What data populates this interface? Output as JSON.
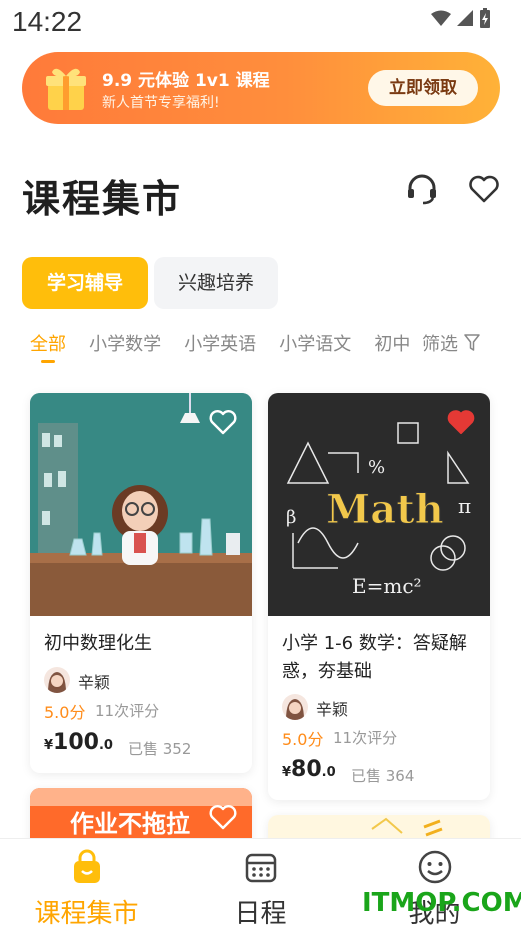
{
  "status": {
    "time": "14:22"
  },
  "promo": {
    "title": "9.9 元体验 1v1 课程",
    "subtitle": "新人首节专享福利!",
    "button": "立即领取"
  },
  "header": {
    "title": "课程集市",
    "support_icon": "headset-icon",
    "favorite_icon": "heart-icon"
  },
  "tabs": [
    {
      "label": "学习辅导",
      "active": true
    },
    {
      "label": "兴趣培养",
      "active": false
    }
  ],
  "subcategories": [
    {
      "label": "全部",
      "active": true
    },
    {
      "label": "小学数学"
    },
    {
      "label": "小学英语"
    },
    {
      "label": "小学语文"
    },
    {
      "label": "初中"
    }
  ],
  "filter": {
    "label": "筛选",
    "icon": "funnel-icon"
  },
  "courses": [
    {
      "title": "初中数理化生",
      "teacher": "辛颖",
      "rating": "5.0分",
      "reviews": "11次评分",
      "price_symbol": "¥",
      "price_int": "100",
      "price_dec": ".0",
      "sold": "已售 352",
      "favorited": false
    },
    {
      "title": "小学 1-6 数学：答疑解惑，夯基础",
      "teacher": "辛颖",
      "rating": "5.0分",
      "reviews": "11次评分",
      "price_symbol": "¥",
      "price_int": "80",
      "price_dec": ".0",
      "sold": "已售 364",
      "favorited": true,
      "image_text": "Math"
    },
    {
      "image_text": "作业不拖拉"
    }
  ],
  "bottom_nav": [
    {
      "label": "课程集市",
      "icon": "shopping-bag-icon",
      "active": true
    },
    {
      "label": "日程",
      "icon": "calendar-icon",
      "active": false
    },
    {
      "label": "我的",
      "icon": "smiley-face-icon",
      "active": false
    }
  ],
  "watermark": "ITMOP.COM",
  "colors": {
    "accent": "#ffbe0b",
    "orange": "#ffa500",
    "favorite_red": "#e53935"
  }
}
